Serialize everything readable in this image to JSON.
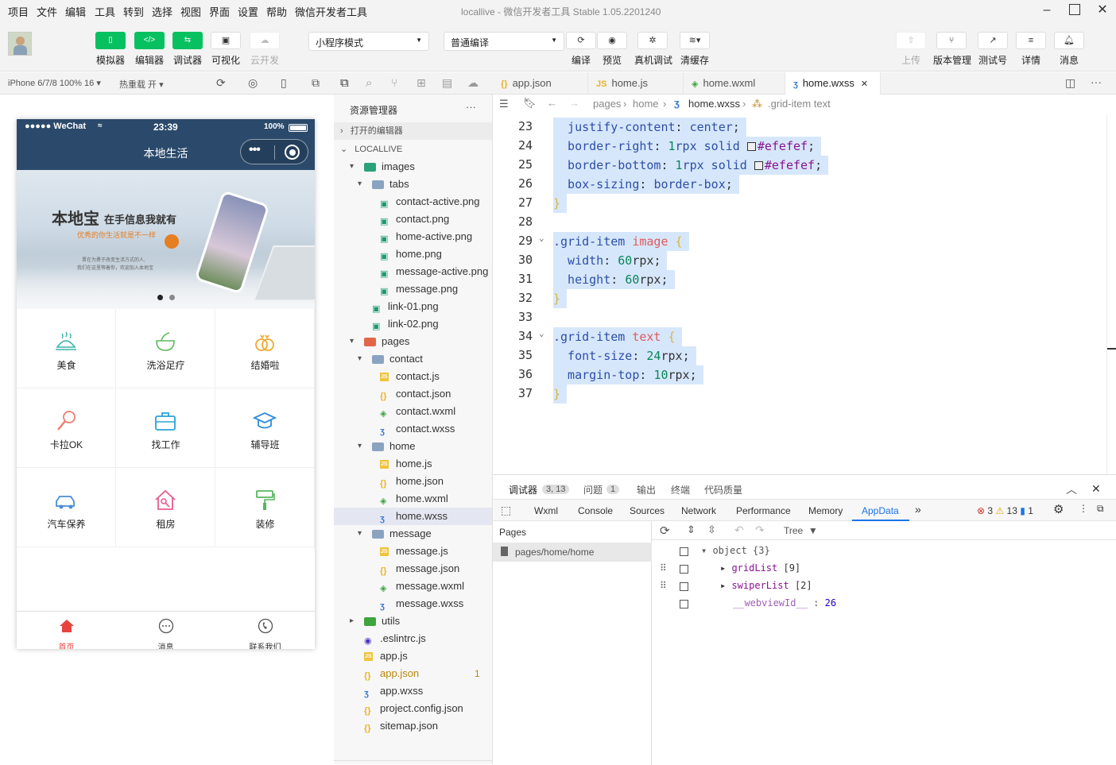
{
  "menu": [
    "项目",
    "文件",
    "编辑",
    "工具",
    "转到",
    "选择",
    "视图",
    "界面",
    "设置",
    "帮助",
    "微信开发者工具"
  ],
  "window_title": "locallive - 微信开发者工具 Stable 1.05.2201240",
  "toolbar": {
    "simulator": "模拟器",
    "editor": "编辑器",
    "debugger": "调试器",
    "visual": "可视化",
    "cloud": "云开发",
    "mode_select": "小程序模式",
    "compile_select": "普通编译",
    "compile": "编译",
    "preview": "预览",
    "real_debug": "真机调试",
    "clear_cache": "清缓存",
    "upload": "上传",
    "version": "版本管理",
    "test_account": "测试号",
    "details": "详情",
    "messages": "消息"
  },
  "sim_bar": {
    "device": "iPhone 6/7/8 100% 16",
    "hot_reload": "热重载 开"
  },
  "phone": {
    "carrier": "●●●●● WeChat",
    "time": "23:39",
    "battery": "100%",
    "nav_title": "本地生活",
    "banner_title": "本地宝",
    "banner_sub1": "在手信息我就有",
    "banner_sub2": "优秀的你生活就是不一样",
    "banner_small1": "晋在为勇于改变生活方式的人,",
    "banner_small2": "我们在这里等着你，欢迎加入本地宝",
    "grid": [
      "美食",
      "洗浴足疗",
      "结婚啦",
      "卡拉OK",
      "找工作",
      "辅导班",
      "汽车保养",
      "租房",
      "装修"
    ],
    "tabs": [
      "首页",
      "消息",
      "联系我们"
    ]
  },
  "explorer": {
    "title": "资源管理器",
    "more": "···",
    "open_editors": "打开的编辑器",
    "project": "LOCALLIVE",
    "tree": [
      {
        "name": "images",
        "depth": 1,
        "type": "folder-img",
        "open": true
      },
      {
        "name": "tabs",
        "depth": 2,
        "type": "folder",
        "open": true
      },
      {
        "name": "contact-active.png",
        "depth": 3,
        "type": "png"
      },
      {
        "name": "contact.png",
        "depth": 3,
        "type": "png"
      },
      {
        "name": "home-active.png",
        "depth": 3,
        "type": "png"
      },
      {
        "name": "home.png",
        "depth": 3,
        "type": "png"
      },
      {
        "name": "message-active.png",
        "depth": 3,
        "type": "png"
      },
      {
        "name": "message.png",
        "depth": 3,
        "type": "png"
      },
      {
        "name": "link-01.png",
        "depth": 2,
        "type": "png"
      },
      {
        "name": "link-02.png",
        "depth": 2,
        "type": "png"
      },
      {
        "name": "pages",
        "depth": 1,
        "type": "folder-pages",
        "open": true
      },
      {
        "name": "contact",
        "depth": 2,
        "type": "folder",
        "open": true
      },
      {
        "name": "contact.js",
        "depth": 3,
        "type": "js"
      },
      {
        "name": "contact.json",
        "depth": 3,
        "type": "json"
      },
      {
        "name": "contact.wxml",
        "depth": 3,
        "type": "wxml"
      },
      {
        "name": "contact.wxss",
        "depth": 3,
        "type": "wxss"
      },
      {
        "name": "home",
        "depth": 2,
        "type": "folder",
        "open": true
      },
      {
        "name": "home.js",
        "depth": 3,
        "type": "js"
      },
      {
        "name": "home.json",
        "depth": 3,
        "type": "json"
      },
      {
        "name": "home.wxml",
        "depth": 3,
        "type": "wxml"
      },
      {
        "name": "home.wxss",
        "depth": 3,
        "type": "wxss",
        "selected": true
      },
      {
        "name": "message",
        "depth": 2,
        "type": "folder",
        "open": true
      },
      {
        "name": "message.js",
        "depth": 3,
        "type": "js"
      },
      {
        "name": "message.json",
        "depth": 3,
        "type": "json"
      },
      {
        "name": "message.wxml",
        "depth": 3,
        "type": "wxml"
      },
      {
        "name": "message.wxss",
        "depth": 3,
        "type": "wxss"
      },
      {
        "name": "utils",
        "depth": 1,
        "type": "folder-utils",
        "open": false
      },
      {
        "name": ".eslintrc.js",
        "depth": 1,
        "type": "eslint"
      },
      {
        "name": "app.js",
        "depth": 1,
        "type": "js"
      },
      {
        "name": "app.json",
        "depth": 1,
        "type": "json",
        "badge": "1",
        "warn": true
      },
      {
        "name": "app.wxss",
        "depth": 1,
        "type": "wxss"
      },
      {
        "name": "project.config.json",
        "depth": 1,
        "type": "json"
      },
      {
        "name": "sitemap.json",
        "depth": 1,
        "type": "json"
      }
    ]
  },
  "editor_tabs": [
    {
      "label": "app.json",
      "type": "json"
    },
    {
      "label": "home.js",
      "type": "js"
    },
    {
      "label": "home.wxml",
      "type": "wxml"
    },
    {
      "label": "home.wxss",
      "type": "wxss",
      "active": true
    }
  ],
  "breadcrumb": [
    "pages",
    "home",
    "home.wxss",
    ".grid-item text"
  ],
  "code": [
    {
      "n": "23",
      "segs": [
        [
          "  justify-content",
          "prop"
        ],
        [
          ": ",
          "p"
        ],
        [
          "center",
          "val"
        ],
        [
          ";",
          "p"
        ]
      ]
    },
    {
      "n": "24",
      "segs": [
        [
          "  border-right",
          "prop"
        ],
        [
          ": ",
          "p"
        ],
        [
          "1",
          "num"
        ],
        [
          "rpx solid ",
          "val"
        ],
        [
          "#efefef",
          "hex"
        ],
        [
          ";",
          "p"
        ]
      ],
      "swatch": true
    },
    {
      "n": "25",
      "segs": [
        [
          "  border-bottom",
          "prop"
        ],
        [
          ": ",
          "p"
        ],
        [
          "1",
          "num"
        ],
        [
          "rpx solid ",
          "val"
        ],
        [
          "#efefef",
          "hex"
        ],
        [
          ";",
          "p"
        ]
      ],
      "swatch": true
    },
    {
      "n": "26",
      "segs": [
        [
          "  box-sizing",
          "prop"
        ],
        [
          ": ",
          "p"
        ],
        [
          "border-box",
          "val"
        ],
        [
          ";",
          "p"
        ]
      ]
    },
    {
      "n": "27",
      "segs": [
        [
          "}",
          "brace"
        ]
      ]
    },
    {
      "n": "28",
      "segs": []
    },
    {
      "n": "29",
      "segs": [
        [
          ".grid-item",
          "sel"
        ],
        [
          " ",
          "p"
        ],
        [
          "image",
          "tag"
        ],
        [
          " {",
          "brace"
        ]
      ],
      "fold": true
    },
    {
      "n": "30",
      "segs": [
        [
          "  width",
          "prop"
        ],
        [
          ": ",
          "p"
        ],
        [
          "60",
          "num"
        ],
        [
          "rpx",
          "p"
        ],
        [
          ";",
          "p"
        ]
      ]
    },
    {
      "n": "31",
      "segs": [
        [
          "  height",
          "prop"
        ],
        [
          ": ",
          "p"
        ],
        [
          "60",
          "num"
        ],
        [
          "rpx",
          "p"
        ],
        [
          ";",
          "p"
        ]
      ]
    },
    {
      "n": "32",
      "segs": [
        [
          "}",
          "brace"
        ]
      ]
    },
    {
      "n": "33",
      "segs": []
    },
    {
      "n": "34",
      "segs": [
        [
          ".grid-item",
          "sel"
        ],
        [
          " ",
          "p"
        ],
        [
          "text",
          "tag"
        ],
        [
          " {",
          "brace"
        ]
      ],
      "fold": true
    },
    {
      "n": "35",
      "segs": [
        [
          "  font-size",
          "prop"
        ],
        [
          ": ",
          "p"
        ],
        [
          "24",
          "num"
        ],
        [
          "rpx",
          "p"
        ],
        [
          ";",
          "p"
        ]
      ]
    },
    {
      "n": "36",
      "segs": [
        [
          "  margin-top",
          "prop"
        ],
        [
          ": ",
          "p"
        ],
        [
          "10",
          "num"
        ],
        [
          "rpx",
          "p"
        ],
        [
          ";",
          "p"
        ]
      ]
    },
    {
      "n": "37",
      "segs": [
        [
          "}",
          "brace"
        ]
      ]
    }
  ],
  "debugger": {
    "top_tabs": [
      "调试器",
      "问题",
      "输出",
      "终端",
      "代码质量"
    ],
    "debugger_badge": "3, 13",
    "problems_badge": "1",
    "tabs": [
      "Wxml",
      "Console",
      "Sources",
      "Network",
      "Performance",
      "Memory",
      "AppData"
    ],
    "active_tab": "AppData",
    "err_count": "3",
    "warn_count": "13",
    "info_count": "1",
    "pages_header": "Pages",
    "page_item": "pages/home/home",
    "view_mode": "Tree",
    "tree": {
      "root": "object {3}",
      "grid": "gridList",
      "grid_len": "[9]",
      "swiper": "swiperList",
      "swiper_len": "[2]",
      "webview_key": "__webviewId__",
      "webview_val": "26"
    }
  },
  "colors": {
    "accent": "#07c160",
    "nav": "#2b4a6b",
    "tab_active": "#e64340",
    "sel_bg": "#d7e7fb"
  }
}
